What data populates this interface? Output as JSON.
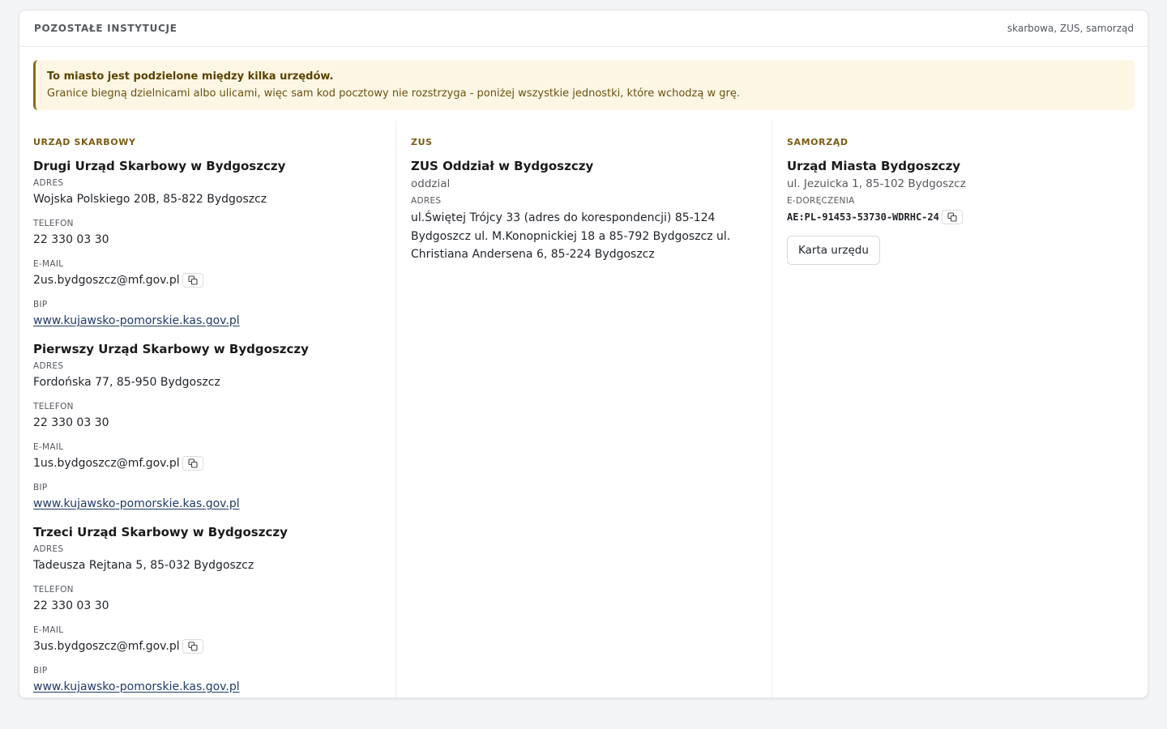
{
  "header": {
    "title": "POZOSTAŁE INSTYTUCJE",
    "subtitle": "skarbowa, ZUS, samorząd"
  },
  "notice": {
    "title": "To miasto jest podzielone między kilka urzędów.",
    "text": "Granice biegną dzielnicami albo ulicami, więc sam kod pocztowy nie rozstrzyga - poniżej wszystkie jednostki, które wchodzą w grę."
  },
  "labels": {
    "address": "ADRES",
    "phone": "TELEFON",
    "email": "E-MAIL",
    "bip": "BIP",
    "edelivery": "E-DORĘCZENIA"
  },
  "tax": {
    "section": "URZĄD SKARBOWY",
    "offices": [
      {
        "name": "Drugi Urząd Skarbowy w Bydgoszczy",
        "address": "Wojska Polskiego 20B, 85-822 Bydgoszcz",
        "phone": "22 330 03 30",
        "email": "2us.bydgoszcz@mf.gov.pl",
        "bip": "www.kujawsko-pomorskie.kas.gov.pl"
      },
      {
        "name": "Pierwszy Urząd Skarbowy w Bydgoszczy",
        "address": "Fordońska 77, 85-950 Bydgoszcz",
        "phone": "22 330 03 30",
        "email": "1us.bydgoszcz@mf.gov.pl",
        "bip": "www.kujawsko-pomorskie.kas.gov.pl"
      },
      {
        "name": "Trzeci Urząd Skarbowy w Bydgoszczy",
        "address": "Tadeusza Rejtana 5, 85-032 Bydgoszcz",
        "phone": "22 330 03 30",
        "email": "3us.bydgoszcz@mf.gov.pl",
        "bip": "www.kujawsko-pomorskie.kas.gov.pl"
      }
    ]
  },
  "zus": {
    "section": "ZUS",
    "name": "ZUS Oddział w Bydgoszczy",
    "type": "oddzial",
    "address": "ul.Świętej Trójcy 33 (adres do korespondencji) 85-124 Bydgoszcz ul. M.Konopnickiej 18 a 85-792 Bydgoszcz ul. Christiana Andersena 6, 85-224 Bydgoszcz"
  },
  "municipal": {
    "section": "SAMORZĄD",
    "name": "Urząd Miasta Bydgoszczy",
    "address": "ul. Jezuicka 1, 85-102 Bydgoszcz",
    "edelivery": "AE:PL-91453-53730-WDRHC-24",
    "button": "Karta urzędu"
  },
  "icons": {
    "copy": "copy-icon"
  }
}
